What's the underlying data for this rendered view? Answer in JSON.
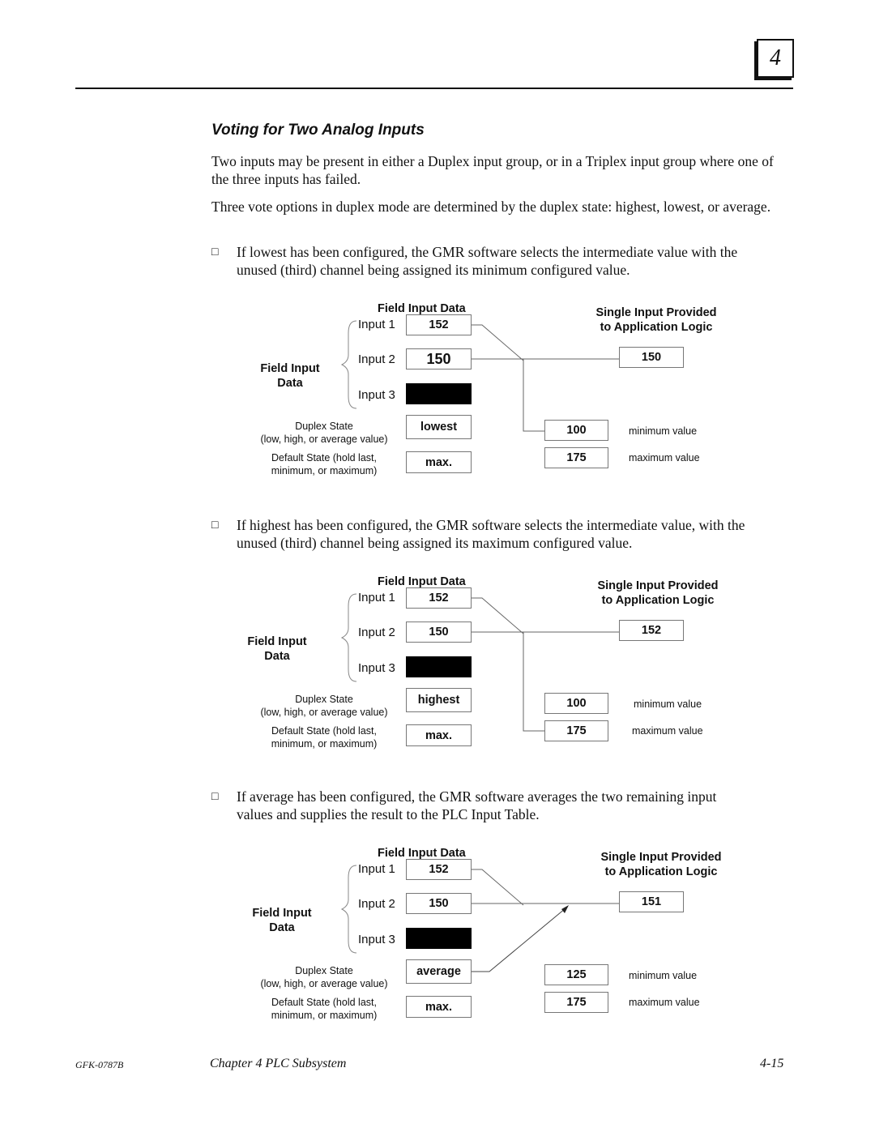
{
  "header": {
    "chapter_number": "4"
  },
  "section_title": "Voting for Two Analog Inputs",
  "paragraphs": [
    "Two inputs may be present in either a Duplex input group, or in a Triplex input group where one of the three inputs has failed.",
    "Three vote options in duplex mode are determined by the duplex state: highest, lowest, or average."
  ],
  "bullets": [
    {
      "symbol": "□",
      "text": "If lowest has been configured, the GMR software selects the intermediate value with the unused (third) channel being assigned its minimum configured value."
    },
    {
      "symbol": "□",
      "text": "If highest has been configured, the GMR software selects the intermediate value, with the unused (third) channel being assigned its maximum configured value."
    },
    {
      "symbol": "□",
      "text": "If average has been configured, the GMR software averages the two remaining input values and supplies the result to the PLC Input Table."
    }
  ],
  "diagrams": [
    {
      "field_input_data_header": "Field Input Data",
      "field_input_data_side": "Field Input\nData",
      "output_header": "Single Input Provided\nto Application Logic",
      "inputs": [
        {
          "label": "Input 1",
          "value": "152"
        },
        {
          "label": "Input 2",
          "value": "150"
        },
        {
          "label": "Input 3",
          "value": "",
          "failed": true
        }
      ],
      "duplex_state_label": "Duplex State\n(low, high, or average value)",
      "duplex_state_value": "lowest",
      "default_state_label": "Default State (hold last,\nminimum, or maximum)",
      "default_state_value": "max.",
      "output_value": "150",
      "min_value": "100",
      "min_label": "minimum value",
      "max_value": "175",
      "max_label": "maximum value"
    },
    {
      "field_input_data_header": "Field Input Data",
      "field_input_data_side": "Field Input\nData",
      "output_header": "Single Input Provided\nto Application Logic",
      "inputs": [
        {
          "label": "Input 1",
          "value": "152"
        },
        {
          "label": "Input 2",
          "value": "150"
        },
        {
          "label": "Input 3",
          "value": "",
          "failed": true
        }
      ],
      "duplex_state_label": "Duplex State\n(low, high, or average value)",
      "duplex_state_value": "highest",
      "default_state_label": "Default State (hold last,\nminimum, or maximum)",
      "default_state_value": "max.",
      "output_value": "152",
      "min_value": "100",
      "min_label": "minimum value",
      "max_value": "175",
      "max_label": "maximum value"
    },
    {
      "field_input_data_header": "Field Input Data",
      "field_input_data_side": "Field Input\nData",
      "output_header": "Single Input Provided\nto Application Logic",
      "inputs": [
        {
          "label": "Input 1",
          "value": "152"
        },
        {
          "label": "Input 2",
          "value": "150"
        },
        {
          "label": "Input 3",
          "value": "",
          "failed": true
        }
      ],
      "duplex_state_label": "Duplex State\n(low, high, or average value)",
      "duplex_state_value": "average",
      "default_state_label": "Default State (hold last,\nminimum, or maximum)",
      "default_state_value": "max.",
      "output_value": "151",
      "min_value": "125",
      "min_label": "minimum value",
      "max_value": "175",
      "max_label": "maximum value"
    }
  ],
  "footer": {
    "doc_id": "GFK-0787B",
    "chapter": "Chapter 4  PLC Subsystem",
    "page": "4-15"
  }
}
